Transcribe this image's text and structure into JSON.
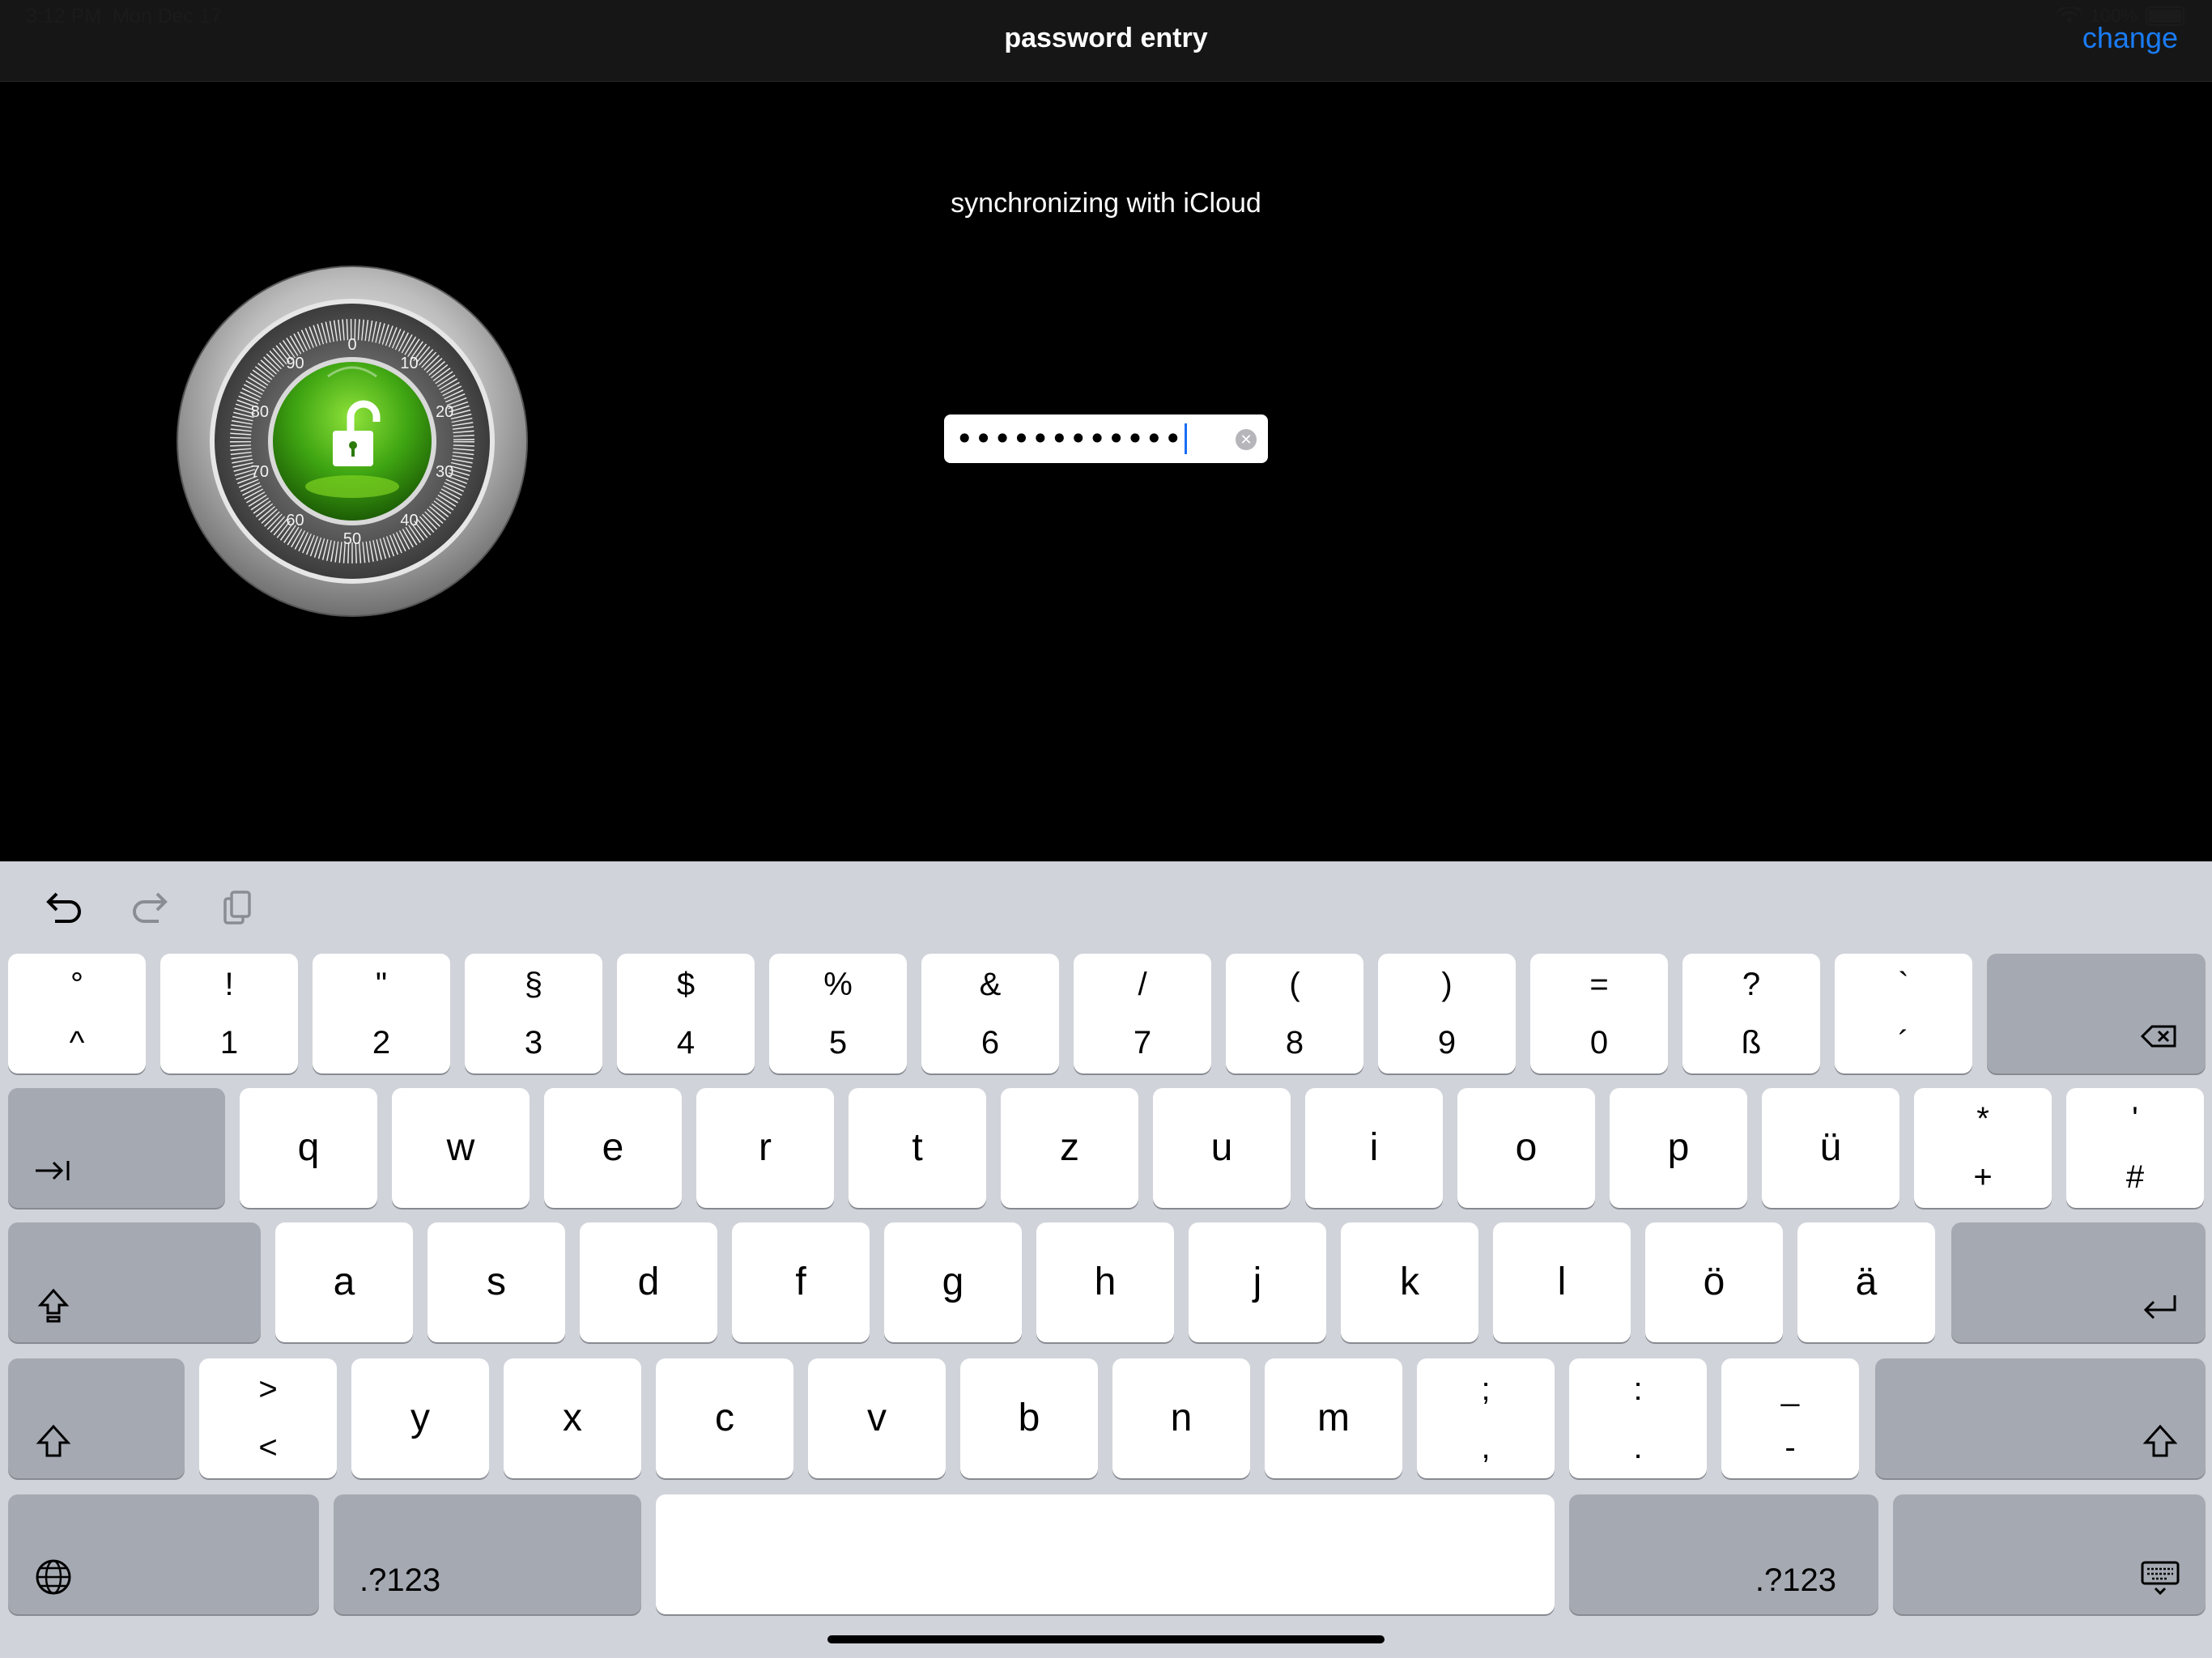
{
  "status": {
    "time": "3:12 PM",
    "date": "Mon Dec 17",
    "battery": "100%"
  },
  "nav": {
    "title": "password entry",
    "right_button": "change"
  },
  "content": {
    "sync_message": "synchronizing with iCloud",
    "dial_numbers": [
      "0",
      "10",
      "20",
      "30",
      "40",
      "50",
      "60",
      "70",
      "80",
      "90"
    ],
    "password_masked": "••••••••••••"
  },
  "keyboard": {
    "row1": [
      {
        "top": "°",
        "bottom": "^"
      },
      {
        "top": "!",
        "bottom": "1"
      },
      {
        "top": "\"",
        "bottom": "2"
      },
      {
        "top": "§",
        "bottom": "3"
      },
      {
        "top": "$",
        "bottom": "4"
      },
      {
        "top": "%",
        "bottom": "5"
      },
      {
        "top": "&",
        "bottom": "6"
      },
      {
        "top": "/",
        "bottom": "7"
      },
      {
        "top": "(",
        "bottom": "8"
      },
      {
        "top": ")",
        "bottom": "9"
      },
      {
        "top": "=",
        "bottom": "0"
      },
      {
        "top": "?",
        "bottom": "ß"
      },
      {
        "top": "`",
        "bottom": "´"
      }
    ],
    "row2": [
      {
        "main": "q"
      },
      {
        "main": "w"
      },
      {
        "main": "e"
      },
      {
        "main": "r"
      },
      {
        "main": "t"
      },
      {
        "main": "z"
      },
      {
        "main": "u"
      },
      {
        "main": "i"
      },
      {
        "main": "o"
      },
      {
        "main": "p"
      },
      {
        "main": "ü"
      },
      {
        "top": "*",
        "bottom": "+"
      },
      {
        "top": "'",
        "bottom": "#"
      }
    ],
    "row3": [
      {
        "main": "a"
      },
      {
        "main": "s"
      },
      {
        "main": "d"
      },
      {
        "main": "f"
      },
      {
        "main": "g"
      },
      {
        "main": "h"
      },
      {
        "main": "j"
      },
      {
        "main": "k"
      },
      {
        "main": "l"
      },
      {
        "main": "ö"
      },
      {
        "main": "ä"
      }
    ],
    "row4": [
      {
        "top": ">",
        "bottom": "<"
      },
      {
        "main": "y"
      },
      {
        "main": "x"
      },
      {
        "main": "c"
      },
      {
        "main": "v"
      },
      {
        "main": "b"
      },
      {
        "main": "n"
      },
      {
        "main": "m"
      },
      {
        "top": ";",
        "bottom": ","
      },
      {
        "top": ":",
        "bottom": "."
      },
      {
        "top": "_",
        "bottom": "-"
      }
    ],
    "numbers_label_left": ".?123",
    "numbers_label_right": ".?123",
    "icons": {
      "undo": "undo-icon",
      "redo": "redo-icon",
      "paste": "clipboard-icon",
      "delete": "delete-backspace-icon",
      "tab": "tab-icon",
      "capslock": "caps-lock-icon",
      "return": "return-icon",
      "shift": "shift-icon",
      "globe": "globe-icon",
      "dismiss": "keyboard-dismiss-icon"
    }
  },
  "colors": {
    "accent": "#1a7cf5",
    "keyboard_bg": "#d0d3d9",
    "key_dark": "#a5a9b2",
    "dial_green": "#3fa512"
  }
}
